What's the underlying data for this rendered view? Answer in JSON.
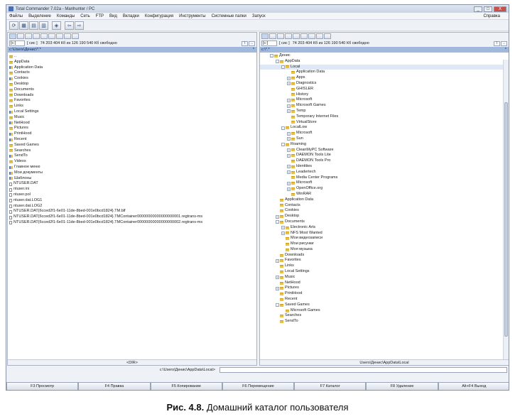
{
  "window": {
    "title": "Total Commander 7.02a - Manhunter / PC",
    "controls": [
      "_",
      "□",
      "X"
    ]
  },
  "menubar": {
    "items": [
      "Файлы",
      "Выделение",
      "Команды",
      "Сеть",
      "FTP",
      "Вид",
      "Вкладки",
      "Конфигурация",
      "Инструменты",
      "Системные папки",
      "Запуск"
    ],
    "right": "Справка"
  },
  "toolbar": {
    "buttons": [
      "⟳",
      "▦",
      "▤",
      "▥",
      "◈",
      "⇦",
      "⇨"
    ]
  },
  "left_panel": {
    "drive": "[c:]",
    "drive_label": "[ сис ]",
    "free": "74 203 404 Кб из 126 190 540 Кб свободно",
    "path": "c:\\Users\\Денис\\*.*",
    "path_arrow": "*",
    "items": [
      {
        "name": "..",
        "type": "folder"
      },
      {
        "name": "AppData",
        "type": "folder"
      },
      {
        "name": "Application Data",
        "type": "link"
      },
      {
        "name": "Contacts",
        "type": "folder"
      },
      {
        "name": "Cookies",
        "type": "link"
      },
      {
        "name": "Desktop",
        "type": "folder"
      },
      {
        "name": "Documents",
        "type": "folder"
      },
      {
        "name": "Downloads",
        "type": "folder"
      },
      {
        "name": "Favorites",
        "type": "folder"
      },
      {
        "name": "Links",
        "type": "folder"
      },
      {
        "name": "Local Settings",
        "type": "link"
      },
      {
        "name": "Music",
        "type": "folder"
      },
      {
        "name": "NetHood",
        "type": "link"
      },
      {
        "name": "Pictures",
        "type": "folder"
      },
      {
        "name": "PrintHood",
        "type": "link"
      },
      {
        "name": "Recent",
        "type": "link"
      },
      {
        "name": "Saved Games",
        "type": "folder"
      },
      {
        "name": "Searches",
        "type": "folder"
      },
      {
        "name": "SendTo",
        "type": "link"
      },
      {
        "name": "Videos",
        "type": "folder"
      },
      {
        "name": "Главное меню",
        "type": "link"
      },
      {
        "name": "Мои документы",
        "type": "link"
      },
      {
        "name": "Шаблоны",
        "type": "link"
      },
      {
        "name": "NTUSER.DAT",
        "type": "file"
      },
      {
        "name": "ntuser.ini",
        "type": "file"
      },
      {
        "name": "ntuser.pol",
        "type": "file"
      },
      {
        "name": "ntuser.dat.LOG1",
        "type": "file"
      },
      {
        "name": "ntuser.dat.LOG2",
        "type": "file"
      },
      {
        "name": "NTUSER.DAT{6cced2f1-6e01-11de-8bed-001e0bcd1824}.TM.blf",
        "type": "file"
      },
      {
        "name": "NTUSER.DAT{6cced2f1-6e01-11de-8bed-001e0bcd1824}.TMContainer00000000000000000001.regtrans-ms",
        "type": "file"
      },
      {
        "name": "NTUSER.DAT{6cced2f1-6e01-11de-8bed-001e0bcd1824}.TMContainer00000000000000000002.regtrans-ms",
        "type": "file"
      }
    ],
    "status": "<DIR>"
  },
  "right_panel": {
    "drive": "[c:]",
    "drive_label": "[ сис ]",
    "free": "74 203 404 Кб из 126 190 540 Кб свободно",
    "path": "c:\\*.*",
    "path_arrow": "*",
    "tree": [
      {
        "name": "Денис",
        "level": 0,
        "exp": "-"
      },
      {
        "name": "AppData",
        "level": 1,
        "exp": "-"
      },
      {
        "name": "Local",
        "level": 2,
        "exp": "-"
      },
      {
        "name": "Application Data",
        "level": 3,
        "exp": ""
      },
      {
        "name": "Apps",
        "level": 3,
        "exp": "+"
      },
      {
        "name": "Diagnostics",
        "level": 3,
        "exp": "+"
      },
      {
        "name": "GHISLER",
        "level": 3,
        "exp": ""
      },
      {
        "name": "History",
        "level": 3,
        "exp": ""
      },
      {
        "name": "Microsoft",
        "level": 3,
        "exp": "+"
      },
      {
        "name": "Microsoft Games",
        "level": 3,
        "exp": "+"
      },
      {
        "name": "Temp",
        "level": 3,
        "exp": "+"
      },
      {
        "name": "Temporary Internet Files",
        "level": 3,
        "exp": ""
      },
      {
        "name": "VirtualStore",
        "level": 3,
        "exp": ""
      },
      {
        "name": "LocalLow",
        "level": 2,
        "exp": "-"
      },
      {
        "name": "Microsoft",
        "level": 3,
        "exp": "+"
      },
      {
        "name": "Sun",
        "level": 3,
        "exp": "+"
      },
      {
        "name": "Roaming",
        "level": 2,
        "exp": "-"
      },
      {
        "name": "CleanMyPC Software",
        "level": 3,
        "exp": "+"
      },
      {
        "name": "DAEMON Tools Lite",
        "level": 3,
        "exp": "+"
      },
      {
        "name": "DAEMON Tools Pro",
        "level": 3,
        "exp": ""
      },
      {
        "name": "Identities",
        "level": 3,
        "exp": "+"
      },
      {
        "name": "Leadertech",
        "level": 3,
        "exp": "+"
      },
      {
        "name": "Media Center Programs",
        "level": 3,
        "exp": ""
      },
      {
        "name": "Microsoft",
        "level": 3,
        "exp": "+"
      },
      {
        "name": "OpenOffice.org",
        "level": 3,
        "exp": "+"
      },
      {
        "name": "WinRAR",
        "level": 3,
        "exp": ""
      },
      {
        "name": "Application Data",
        "level": 1,
        "exp": ""
      },
      {
        "name": "Contacts",
        "level": 1,
        "exp": ""
      },
      {
        "name": "Cookies",
        "level": 1,
        "exp": ""
      },
      {
        "name": "Desktop",
        "level": 1,
        "exp": "+"
      },
      {
        "name": "Documents",
        "level": 1,
        "exp": "-"
      },
      {
        "name": "Electronic Arts",
        "level": 2,
        "exp": "+"
      },
      {
        "name": "NFS Most Wanted",
        "level": 2,
        "exp": "+"
      },
      {
        "name": "Мои видеозаписи",
        "level": 2,
        "exp": ""
      },
      {
        "name": "Мои рисунки",
        "level": 2,
        "exp": ""
      },
      {
        "name": "Моя музыка",
        "level": 2,
        "exp": ""
      },
      {
        "name": "Downloads",
        "level": 1,
        "exp": ""
      },
      {
        "name": "Favorites",
        "level": 1,
        "exp": "+"
      },
      {
        "name": "Links",
        "level": 1,
        "exp": ""
      },
      {
        "name": "Local Settings",
        "level": 1,
        "exp": ""
      },
      {
        "name": "Music",
        "level": 1,
        "exp": "+"
      },
      {
        "name": "NetHood",
        "level": 1,
        "exp": ""
      },
      {
        "name": "Pictures",
        "level": 1,
        "exp": "+"
      },
      {
        "name": "PrintHood",
        "level": 1,
        "exp": ""
      },
      {
        "name": "Recent",
        "level": 1,
        "exp": ""
      },
      {
        "name": "Saved Games",
        "level": 1,
        "exp": "-"
      },
      {
        "name": "Microsoft Games",
        "level": 2,
        "exp": ""
      },
      {
        "name": "Searches",
        "level": 1,
        "exp": ""
      },
      {
        "name": "SendTo",
        "level": 1,
        "exp": ""
      }
    ],
    "status": "Users\\Денис\\AppData\\Local"
  },
  "cmdline": {
    "label": "c:\\Users\\Денис\\AppData\\Local>"
  },
  "pathrow": {
    "left": "<DIR>",
    "right": "Users\\Денис\\AppData\\Local"
  },
  "fkeys": [
    "F3 Просмотр",
    "F4 Правка",
    "F5 Копирование",
    "F6 Перемещение",
    "F7 Каталог",
    "F8 Удаление",
    "Alt+F4 Выход"
  ],
  "caption": {
    "bold": "Рис. 4.8.",
    "text": " Домашний каталог пользователя"
  },
  "colors": {
    "path_highlight": "#9fb8dc",
    "folder": "#e6c04d"
  }
}
